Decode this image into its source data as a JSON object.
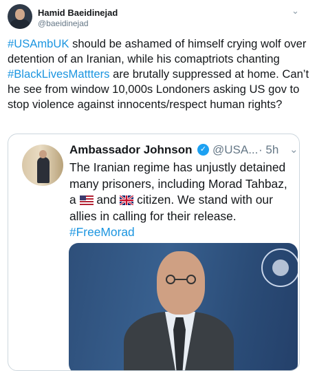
{
  "tweet": {
    "author_name": "Hamid Baeidinejad",
    "author_handle": "@baeidinejad",
    "text_parts": [
      {
        "text": "#USAmbUK",
        "tag": true
      },
      {
        "text": " should be ashamed of himself crying wolf over detention of an Iranian, while his comaptriots chanting ",
        "tag": false
      },
      {
        "text": "#BlackLivesMattters",
        "tag": true
      },
      {
        "text": " are brutally suppressed at home. Can’t he see from window 10,000s Londoners asking US gov to stop violence against innocents/respect human rights?",
        "tag": false
      }
    ],
    "menu_icon": "chevron-down-icon"
  },
  "quoted": {
    "author_name": "Ambassador Johnson",
    "handle": "@USA...",
    "time": "· 5h",
    "verified_icon": "verified-badge-icon",
    "text_line1": "The Iranian regime has unjustly detained many prisoners, including Morad Tahbaz,",
    "text_a": "a",
    "text_and": "and",
    "text_rest": "citizen. We stand with our allies in calling for their release.",
    "hashtag": "#FreeMorad",
    "flag1_icon": "us-flag-icon",
    "flag2_icon": "uk-flag-icon",
    "media_icon": "video-still"
  },
  "colors": {
    "link": "#1b95e0",
    "text": "#14171a",
    "muted": "#657786",
    "verified": "#1da1f2"
  }
}
